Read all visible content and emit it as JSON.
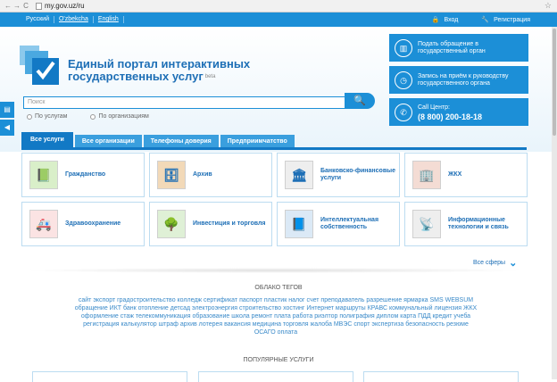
{
  "browser": {
    "back": "←",
    "forward": "→",
    "reload": "C",
    "url": "my.gov.uz/ru"
  },
  "topbar": {
    "languages": [
      "Русский",
      "O'zbekcha",
      "English"
    ],
    "login": "Вход",
    "register": "Регистрация"
  },
  "header": {
    "title_line1": "Единый портал интерактивных",
    "title_line2": "государственных услуг",
    "beta": "beta",
    "search_placeholder": "Поиск",
    "radio_services": "По услугам",
    "radio_orgs": "По организациям"
  },
  "actions": {
    "appeal": "Подать обращение в государственный орган",
    "appointment": "Запись на приём к руководству государственного органа",
    "callcenter_label": "Call Центр:",
    "callcenter_phone": "(8 800) 200-18-18"
  },
  "tabs": [
    "Все услуги",
    "Все организации",
    "Телефоны доверия",
    "Предприимчатство"
  ],
  "categories": [
    {
      "label": "Гражданство",
      "icon": "passport-icon"
    },
    {
      "label": "Архив",
      "icon": "archive-icon"
    },
    {
      "label": "Банковско-финансовые услуги",
      "icon": "bank-icon"
    },
    {
      "label": "ЖКХ",
      "icon": "building-icon"
    },
    {
      "label": "Здравоохранение",
      "icon": "ambulance-icon"
    },
    {
      "label": "Инвестиция и торговля",
      "icon": "tree-icon"
    },
    {
      "label": "Интеллектуальная собственность",
      "icon": "book-icon"
    },
    {
      "label": "Информационные технологии и связь",
      "icon": "satellite-icon"
    }
  ],
  "all_spheres": "Все сферы",
  "cloud_title": "ОБЛАКО ТЕГОВ",
  "cloud_lines": [
    "сайт экспорт градостроительство колледж сертификат паспорт пластик налог счет преподаватель разрешение ярмарка SMS WEBSUM",
    "обращение ИКТ банк отопление детсад электроэнергия строительство хостинг Интернет маршруты КРАВС коммунальный лицензия ЖКХ",
    "оформление стаж телекоммуникация образование школа ремонт плата работа риэлтор полиграфия диплом карта ПДД кредит учеба",
    "регистрация калькулятор штраф архив лотерея вакансия медицина торговля жалоба МВЭС спорт экспертиза безопасность резюме",
    "ОСАГО оплата"
  ],
  "popular_title": "ПОПУЛЯРНЫЕ УСЛУГИ"
}
